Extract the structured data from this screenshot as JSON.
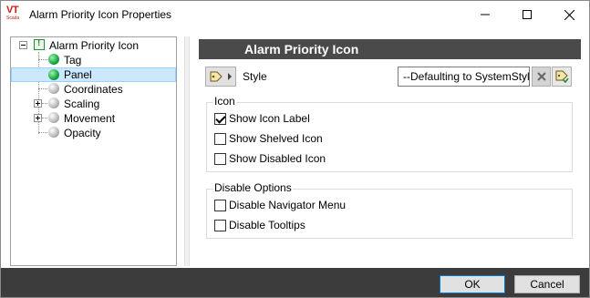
{
  "window": {
    "title": "Alarm Priority Icon Properties",
    "logo_text": "VT",
    "logo_sub": "Scada"
  },
  "tree": {
    "items": [
      {
        "label": "Alarm Priority Icon",
        "icon": "alarm-priority-root-icon"
      },
      {
        "label": "Tag",
        "icon": "green-ball-icon"
      },
      {
        "label": "Panel",
        "icon": "green-ball-icon",
        "selected": true
      },
      {
        "label": "Coordinates",
        "icon": "gray-ball-icon"
      },
      {
        "label": "Scaling",
        "icon": "gray-ball-icon",
        "expandable": true
      },
      {
        "label": "Movement",
        "icon": "gray-ball-icon",
        "expandable": true
      },
      {
        "label": "Opacity",
        "icon": "gray-ball-icon"
      }
    ]
  },
  "panel": {
    "header": "Alarm Priority Icon",
    "style_label": "Style",
    "style_value": "--Defaulting to SystemStyle--",
    "icon_group": {
      "title": "Icon",
      "options": [
        {
          "label": "Show Icon Label",
          "checked": true
        },
        {
          "label": "Show Shelved Icon",
          "checked": false
        },
        {
          "label": "Show Disabled Icon",
          "checked": false
        }
      ]
    },
    "disable_group": {
      "title": "Disable Options",
      "options": [
        {
          "label": "Disable Navigator Menu",
          "checked": false
        },
        {
          "label": "Disable Tooltips",
          "checked": false
        }
      ]
    }
  },
  "footer": {
    "ok_label": "OK",
    "cancel_label": "Cancel"
  },
  "colors": {
    "header_bg": "#4a4a4a",
    "footer_bg": "#3c3c3c",
    "selection": "#cce8ff",
    "logo_red": "#d01818"
  }
}
